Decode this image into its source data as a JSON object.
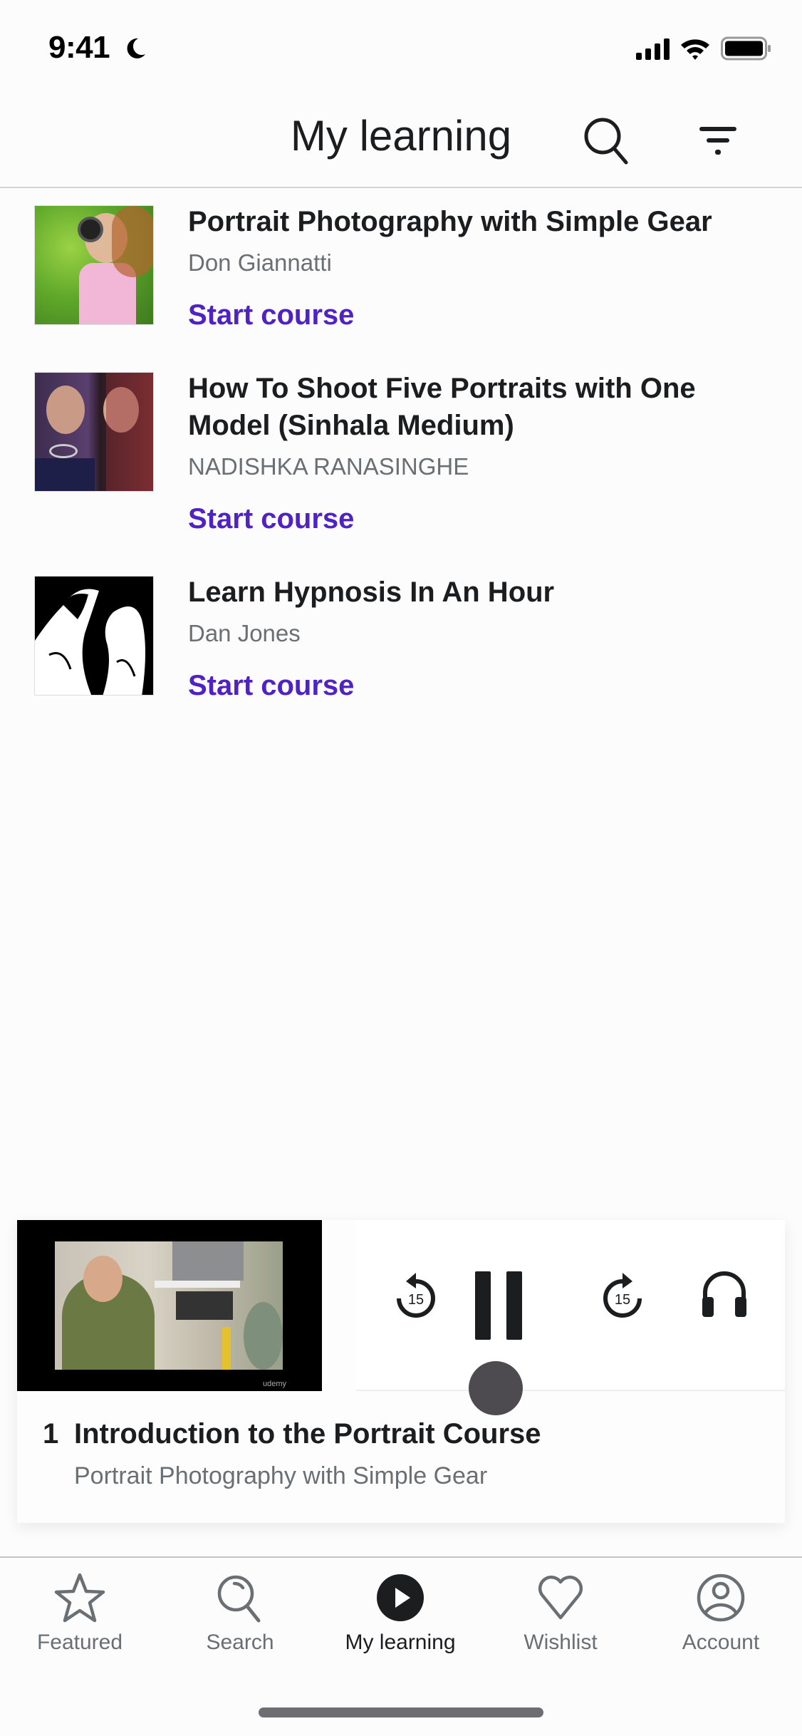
{
  "status_bar": {
    "time": "9:41",
    "icons": [
      "moon-icon",
      "signal-icon",
      "wifi-icon",
      "battery-icon"
    ]
  },
  "header": {
    "title": "My learning",
    "search_icon": "search-icon",
    "filter_icon": "filter-icon"
  },
  "courses": [
    {
      "title": "Portrait Photography with Simple Gear",
      "author": "Don Giannatti",
      "action": "Start course"
    },
    {
      "title": "How To Shoot Five Portraits with One Model (Sinhala Medium)",
      "author": "NADISHKA RANASINGHE",
      "action": "Start course"
    },
    {
      "title": "Learn Hypnosis In An Hour",
      "author": "Dan Jones",
      "action": "Start course"
    }
  ],
  "player": {
    "lecture_number": "1",
    "lecture_title": "Introduction to the Portrait Course",
    "course_title": "Portrait Photography with Simple Gear",
    "watermark": "udemy",
    "rewind_seconds": "15",
    "forward_seconds": "15",
    "state": "playing"
  },
  "tabs": [
    {
      "label": "Featured",
      "icon": "star-icon",
      "active": false
    },
    {
      "label": "Search",
      "icon": "search-icon",
      "active": false
    },
    {
      "label": "My learning",
      "icon": "play-circle-icon",
      "active": true
    },
    {
      "label": "Wishlist",
      "icon": "heart-icon",
      "active": false
    },
    {
      "label": "Account",
      "icon": "account-icon",
      "active": false
    }
  ],
  "colors": {
    "accent": "#5022c3",
    "text": "#1c1d1f",
    "muted": "#6a6f73"
  }
}
